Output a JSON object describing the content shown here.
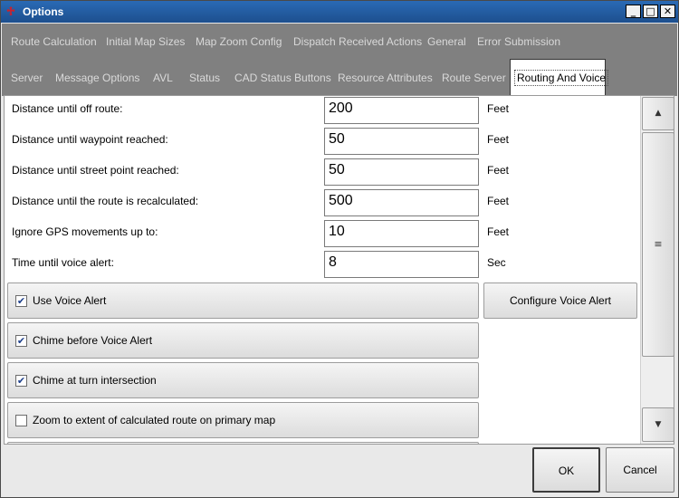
{
  "window": {
    "title": "Options",
    "controls": {
      "minimize": "_",
      "maximize": "□",
      "close": "✕"
    }
  },
  "tabs_row1": [
    "Route Calculation",
    "Initial Map Sizes",
    "Map Zoom Config",
    "Dispatch Received Actions",
    "General",
    "Error Submission"
  ],
  "tabs_row2": [
    "Server",
    "Message Options",
    "AVL",
    "Status",
    "CAD Status Buttons",
    "Resource Attributes",
    "Route Server",
    "Routing And Voice"
  ],
  "active_tab": "Routing And Voice",
  "fields": [
    {
      "label": "Distance until off route:",
      "value": "200",
      "unit": "Feet"
    },
    {
      "label": "Distance until waypoint reached:",
      "value": "50",
      "unit": "Feet"
    },
    {
      "label": "Distance until street point reached:",
      "value": "50",
      "unit": "Feet"
    },
    {
      "label": "Distance until the route is recalculated:",
      "value": "500",
      "unit": "Feet"
    },
    {
      "label": "Ignore GPS movements up to:",
      "value": "10",
      "unit": "Feet"
    },
    {
      "label": "Time until voice alert:",
      "value": "8",
      "unit": "Sec"
    }
  ],
  "checkboxes": [
    {
      "label": "Use Voice Alert",
      "checked": true
    },
    {
      "label": "Chime before Voice Alert",
      "checked": true
    },
    {
      "label": "Chime at turn intersection",
      "checked": true
    },
    {
      "label": "Zoom to extent of calculated route on primary map",
      "checked": false
    }
  ],
  "configure_button": "Configure Voice Alert",
  "scrollbar": {
    "up": "▲",
    "thumb": "≡",
    "down": "▼"
  },
  "buttons": {
    "ok": "OK",
    "cancel": "Cancel"
  },
  "colors": {
    "titlebar": "#1d4f8e",
    "tab_strip": "#808080",
    "active_tab": "#ffffff"
  }
}
